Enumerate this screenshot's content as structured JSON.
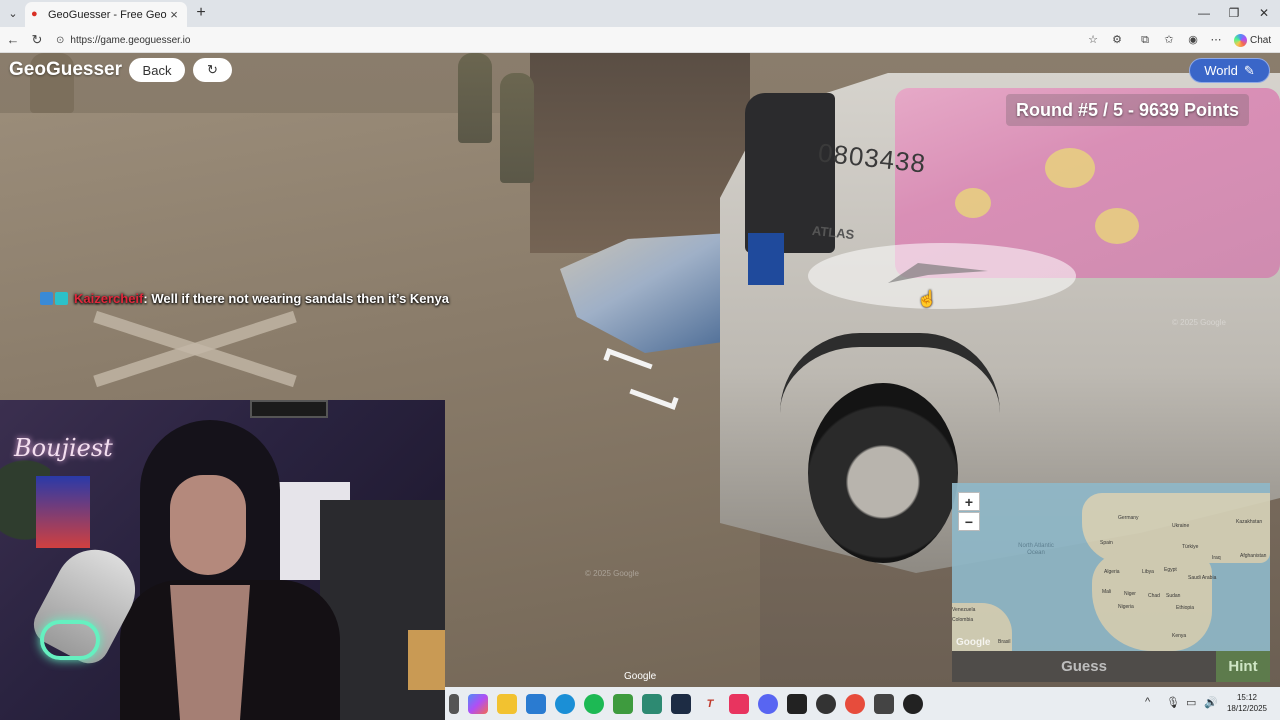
{
  "browser": {
    "tab_title": "GeoGuesser - Free GeoGuessr Ga",
    "url": "https://game.geoguesser.io",
    "chat_label": "Chat"
  },
  "game": {
    "logo": "GeoGuesser",
    "back_label": "Back",
    "world_label": "World",
    "round_text": "Round #5 / 5 - 9639 Points",
    "guess_label": "Guess",
    "hint_label": "Hint",
    "google_label": "Google",
    "zoom_in": "+",
    "zoom_out": "−"
  },
  "street_view": {
    "truck_plate": "0803438",
    "truck_brand": "ATLAS",
    "copyright": "© 2025 Google"
  },
  "chat_overlay": {
    "username": "Kaizercheif",
    "message": ": Well if there not wearing sandals then it’s Kenya"
  },
  "minimap": {
    "labels": [
      "Germany",
      "Kazakhstan",
      "Ukraine",
      "Türkiye",
      "Spain",
      "Iraq",
      "Afghanistan",
      "Algeria",
      "Libya",
      "Egypt",
      "Saudi Arabia",
      "Mali",
      "Niger",
      "Chad",
      "Sudan",
      "Nigeria",
      "Ethiopia",
      "Venezuela",
      "Colombia",
      "Brasil",
      "Kenya"
    ],
    "ocean": "North Atlantic Ocean",
    "attribution": "Google"
  },
  "webcam": {
    "neon_sign": "Boujiest"
  },
  "taskbar": {
    "time": "15:12",
    "date": "18/12/2025"
  }
}
